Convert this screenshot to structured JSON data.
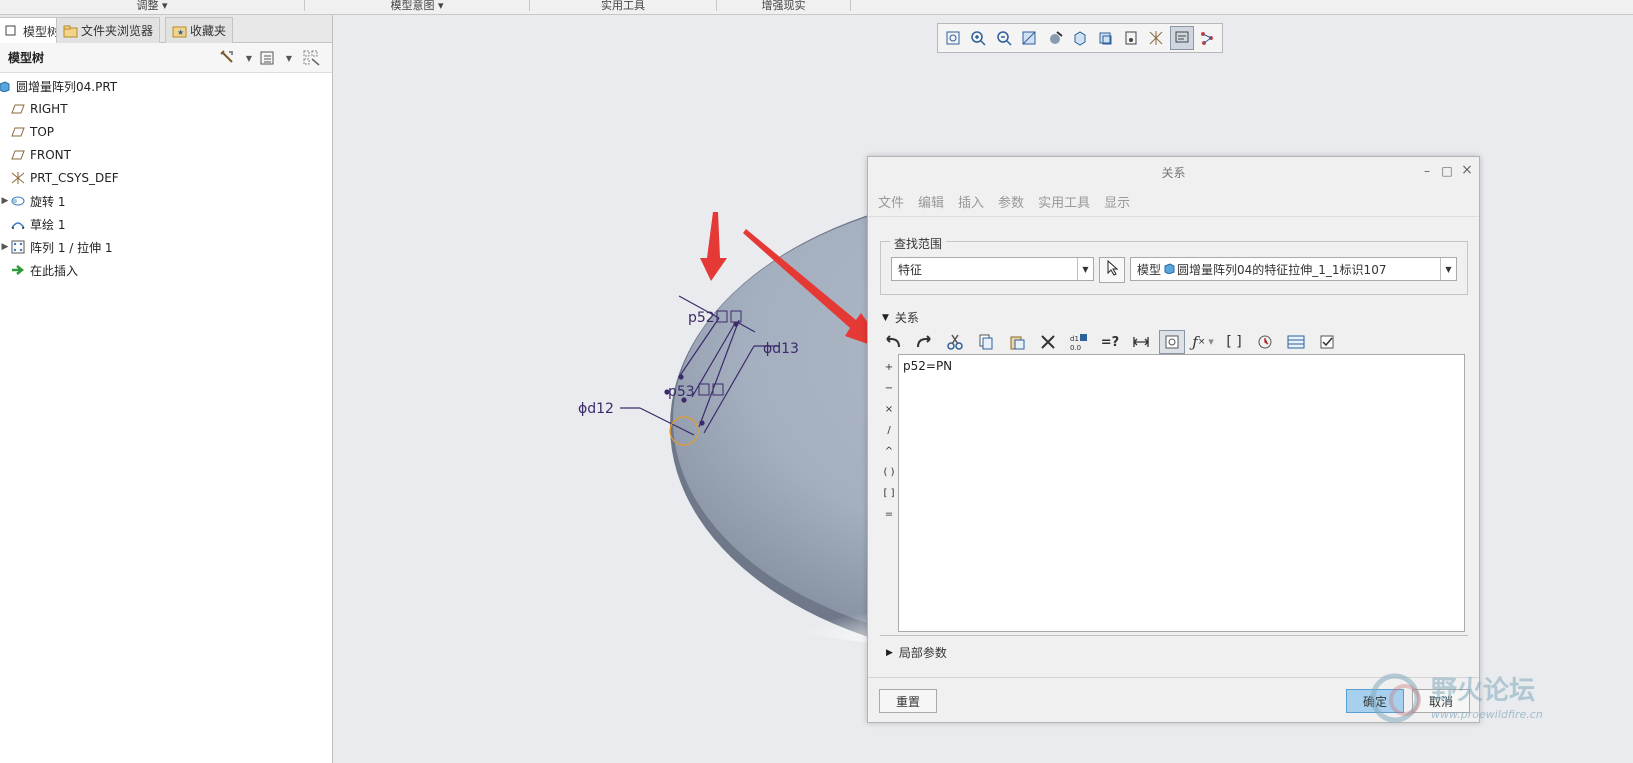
{
  "ribbon": {
    "groups": [
      "调整 ▾",
      "模型意图 ▾",
      "实用工具",
      "增强现实"
    ]
  },
  "left_panel": {
    "tabs": [
      {
        "label": "模型树",
        "icon": "tree-icon"
      },
      {
        "label": "文件夹浏览器",
        "icon": "folder-icon"
      },
      {
        "label": "收藏夹",
        "icon": "favorites-icon"
      }
    ],
    "tree_header": "模型树",
    "tree_items": [
      {
        "label": "圆增量阵列04.PRT",
        "icon": "part-icon",
        "expander": ""
      },
      {
        "label": "RIGHT",
        "icon": "datum-plane-icon",
        "expander": ""
      },
      {
        "label": "TOP",
        "icon": "datum-plane-icon",
        "expander": ""
      },
      {
        "label": "FRONT",
        "icon": "datum-plane-icon",
        "expander": ""
      },
      {
        "label": "PRT_CSYS_DEF",
        "icon": "csys-icon",
        "expander": ""
      },
      {
        "label": "旋转 1",
        "icon": "revolve-icon",
        "expander": "▶"
      },
      {
        "label": "草绘 1",
        "icon": "sketch-icon",
        "expander": ""
      },
      {
        "label": "阵列 1 / 拉伸 1",
        "icon": "pattern-icon",
        "expander": "▶"
      },
      {
        "label": "在此插入",
        "icon": "insert-here-icon",
        "expander": ""
      }
    ]
  },
  "annotations": {
    "p52": "p52",
    "p53": "p53",
    "d13": "ϕd13",
    "d12": "ϕd12"
  },
  "dialog": {
    "title": "关系",
    "menu": [
      "文件",
      "编辑",
      "插入",
      "参数",
      "实用工具",
      "显示"
    ],
    "scope_label": "查找范围",
    "scope_type": "特征",
    "scope_model_prefix": "模型",
    "scope_model": "圆增量阵列04的特征拉伸_1_1标识107",
    "relations_label": "关系",
    "operators": [
      "+",
      "−",
      "×",
      "/",
      "^",
      "( )",
      "[ ]",
      "="
    ],
    "relation_text": "p52=PN",
    "local_params_label": "局部参数",
    "reset_label": "重置",
    "ok_label": "确定",
    "cancel_label": "取消"
  },
  "watermark": {
    "text": "野火论坛",
    "url": "www.proewildfire.cn"
  },
  "colors": {
    "disc": "#a8b3c3",
    "annotation": "#3c2a6b",
    "arrow": "#e53935",
    "ok_button": "#a6d0ee"
  }
}
